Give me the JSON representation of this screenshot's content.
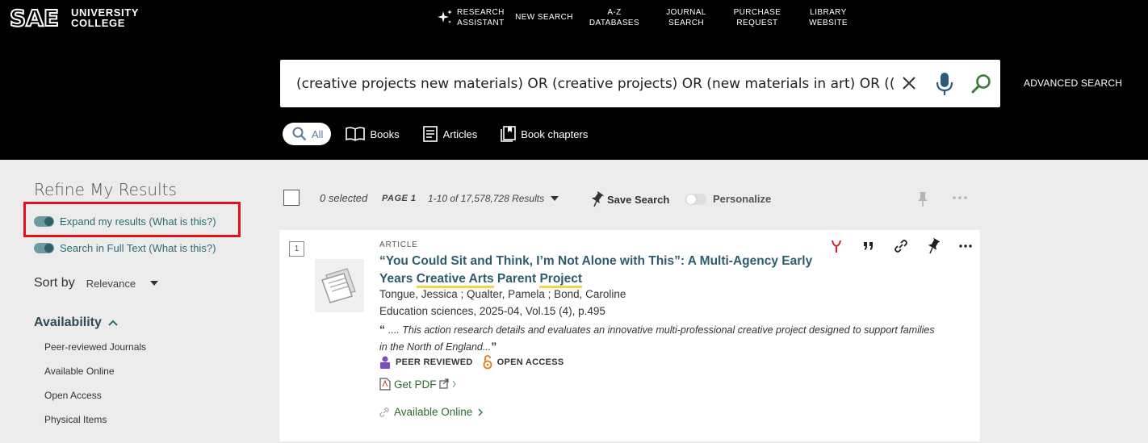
{
  "header": {
    "logo": {
      "mark": "SAE",
      "line1": "UNIVERSITY",
      "line2": "COLLEGE"
    },
    "nav": [
      {
        "label": "RESEARCH\nASSISTANT",
        "icon": "sparkle-icon"
      },
      {
        "label": "NEW SEARCH"
      },
      {
        "label": "A-Z\nDATABASES"
      },
      {
        "label": "JOURNAL\nSEARCH"
      },
      {
        "label": "PURCHASE\nREQUEST"
      },
      {
        "label": "LIBRARY\nWEBSITE"
      }
    ],
    "search": {
      "value": "(creative projects new materials) OR (creative projects) OR (new materials in art) OR ((creativ"
    },
    "advanced_search": "ADVANCED SEARCH",
    "scopes": [
      {
        "label": "All",
        "active": true
      },
      {
        "label": "Books"
      },
      {
        "label": "Articles"
      },
      {
        "label": "Book chapters"
      }
    ]
  },
  "sidebar": {
    "title": "Refine My Results",
    "expand": {
      "label": "Expand my results (",
      "link": "What is this?",
      "close": ")"
    },
    "fulltext": {
      "label": "Search in Full Text (",
      "link": "What is this?",
      "close": ")"
    },
    "sort": {
      "label": "Sort by",
      "value": "Relevance"
    },
    "availability": {
      "title": "Availability",
      "items": [
        "Peer-reviewed Journals",
        "Available Online",
        "Open Access",
        "Physical Items"
      ]
    }
  },
  "results_bar": {
    "selected": "0 selected",
    "page": "PAGE 1",
    "count": "1-10 of 17,578,728 Results",
    "save_search": "Save Search",
    "personalize": "Personalize"
  },
  "result": {
    "number": "1",
    "type": "ARTICLE",
    "title_parts": [
      "“You Could Sit and Think, I’m Not Alone with This”: A Multi-Agency Early Years ",
      "Creative Arts",
      " Parent ",
      "Project"
    ],
    "authors": "Tongue, Jessica ; Qualter, Pamela ; Bond, Caroline",
    "source": "Education sciences, 2025-04, Vol.15 (4), p.495",
    "snippet": ".... This action research details and evaluates an innovative multi-professional creative project designed to support families in the North of England...",
    "badges": {
      "peer": "PEER REVIEWED",
      "open": "OPEN ACCESS"
    },
    "get_pdf": "Get PDF",
    "available_online": "Available Online"
  },
  "colors": {
    "accent": "#2d6b73",
    "highlight_box": "#e3111b",
    "link_green": "#2d6a2d",
    "title": "#2e5c6e"
  }
}
